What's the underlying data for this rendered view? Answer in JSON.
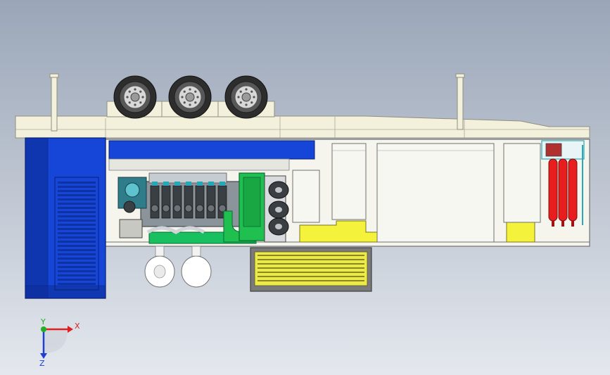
{
  "axes": {
    "x_label": "X",
    "y_label": "Y",
    "z_label": "Z",
    "x_color": "#e02020",
    "y_color": "#20b020",
    "z_color": "#2040d0"
  },
  "colors": {
    "frame": "#f3f1dc",
    "frame_stroke": "#8f8f80",
    "radiator": "#1546d8",
    "radiator_dark": "#0d2f9a",
    "engine": "#9aa4ad",
    "engine_block": "#3a3f44",
    "engine_teal": "#2aa7b5",
    "engine_base": "#18c060",
    "generator": "#20c050",
    "muffler": "#ece94a",
    "fuel_tank": "#f4f23a",
    "cabinet": "#f7f7f2",
    "gas_cylinder": "#e81e1e",
    "tire": "#2d2d2d",
    "panel_line": "#6c6c70"
  },
  "components": [
    "semi-trailer-frame",
    "wheel-axles",
    "radiator",
    "engine",
    "generator",
    "air-filters",
    "muffler",
    "control-cabinets",
    "fire-extinguisher-cylinders"
  ]
}
